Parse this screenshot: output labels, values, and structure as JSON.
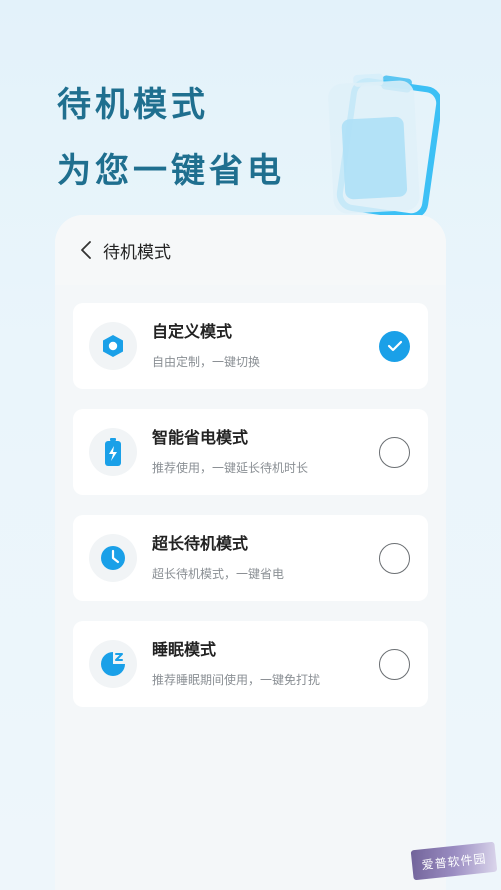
{
  "hero": {
    "line1": "待机模式",
    "line2": "为您一键省电"
  },
  "header": {
    "title": "待机模式"
  },
  "modes": [
    {
      "name": "自定义模式",
      "desc": "自由定制，一键切换",
      "icon": "hexagon-icon",
      "checked": true
    },
    {
      "name": "智能省电模式",
      "desc": "推荐使用，一键延长待机时长",
      "icon": "battery-bolt-icon",
      "checked": false
    },
    {
      "name": "超长待机模式",
      "desc": "超长待机模式，一键省电",
      "icon": "clock-icon",
      "checked": false
    },
    {
      "name": "睡眠模式",
      "desc": "推荐睡眠期间使用，一键免打扰",
      "icon": "sleep-moon-icon",
      "checked": false
    }
  ],
  "colors": {
    "accent": "#1aa0e8",
    "hero_text": "#1f6f8f"
  },
  "watermark": "爱普软件园"
}
